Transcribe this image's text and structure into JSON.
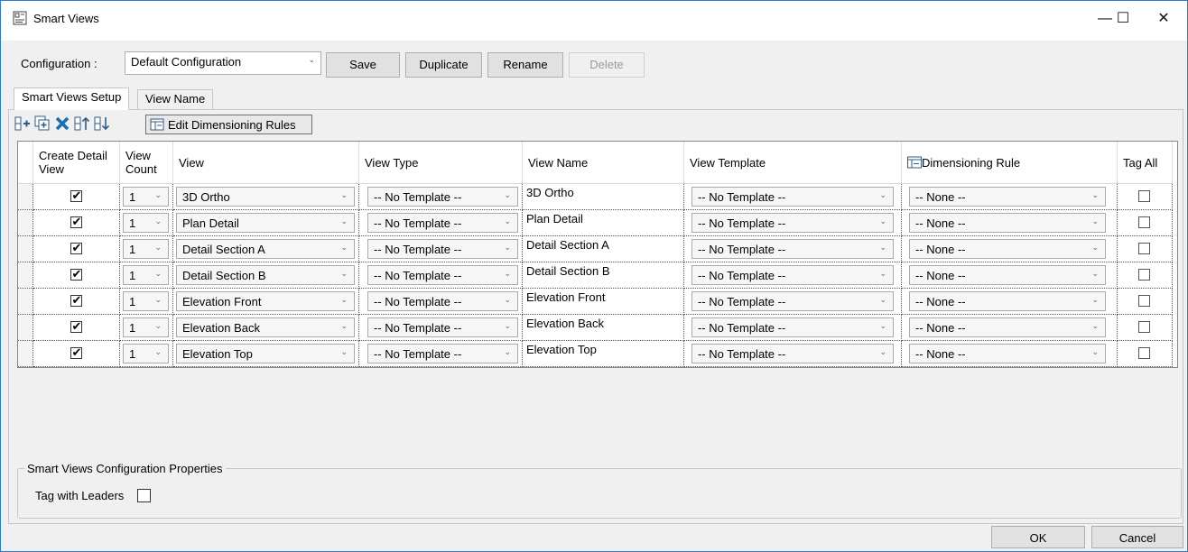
{
  "window": {
    "title": "Smart Views",
    "minimize": "—",
    "maximize": "☐",
    "close": "✕"
  },
  "config": {
    "label": "Configuration  :",
    "selected": "Default Configuration",
    "buttons": {
      "save": "Save",
      "duplicate": "Duplicate",
      "rename": "Rename",
      "delete": "Delete"
    }
  },
  "tabs": [
    {
      "label": "Smart Views Setup"
    },
    {
      "label": "View Name"
    }
  ],
  "toolbar": {
    "edit_rules": "Edit Dimensioning Rules"
  },
  "grid": {
    "headers": {
      "create": "Create Detail View",
      "count": "View Count",
      "view": "View",
      "view_type": "View Type",
      "view_name": "View Name",
      "view_template": "View Template",
      "dim_rule": "Dimensioning Rule",
      "tag_all": "Tag All"
    },
    "rows": [
      {
        "create": true,
        "count": "1",
        "view": "3D Ortho",
        "view_type": "-- No Template --",
        "view_name": "3D Ortho",
        "view_template": "-- No Template --",
        "dim_rule": "-- None --",
        "tag_all": false
      },
      {
        "create": true,
        "count": "1",
        "view": "Plan Detail",
        "view_type": "-- No Template --",
        "view_name": "Plan Detail",
        "view_template": "-- No Template --",
        "dim_rule": "-- None --",
        "tag_all": false
      },
      {
        "create": true,
        "count": "1",
        "view": "Detail Section A",
        "view_type": "-- No Template --",
        "view_name": "Detail Section A",
        "view_template": "-- No Template --",
        "dim_rule": "-- None --",
        "tag_all": false
      },
      {
        "create": true,
        "count": "1",
        "view": "Detail Section B",
        "view_type": "-- No Template --",
        "view_name": "Detail Section B",
        "view_template": "-- No Template --",
        "dim_rule": "-- None --",
        "tag_all": false
      },
      {
        "create": true,
        "count": "1",
        "view": "Elevation Front",
        "view_type": "-- No Template --",
        "view_name": "Elevation Front",
        "view_template": "-- No Template --",
        "dim_rule": "-- None --",
        "tag_all": false
      },
      {
        "create": true,
        "count": "1",
        "view": "Elevation Back",
        "view_type": "-- No Template --",
        "view_name": "Elevation Back",
        "view_template": "-- No Template --",
        "dim_rule": "-- None --",
        "tag_all": false
      },
      {
        "create": true,
        "count": "1",
        "view": "Elevation Top",
        "view_type": "-- No Template --",
        "view_name": "Elevation Top",
        "view_template": "-- No Template --",
        "dim_rule": "-- None --",
        "tag_all": false
      }
    ]
  },
  "properties": {
    "title": "Smart Views Configuration Properties",
    "tag_with_leaders_label": "Tag with Leaders",
    "tag_with_leaders": false
  },
  "footer": {
    "ok": "OK",
    "cancel": "Cancel"
  }
}
